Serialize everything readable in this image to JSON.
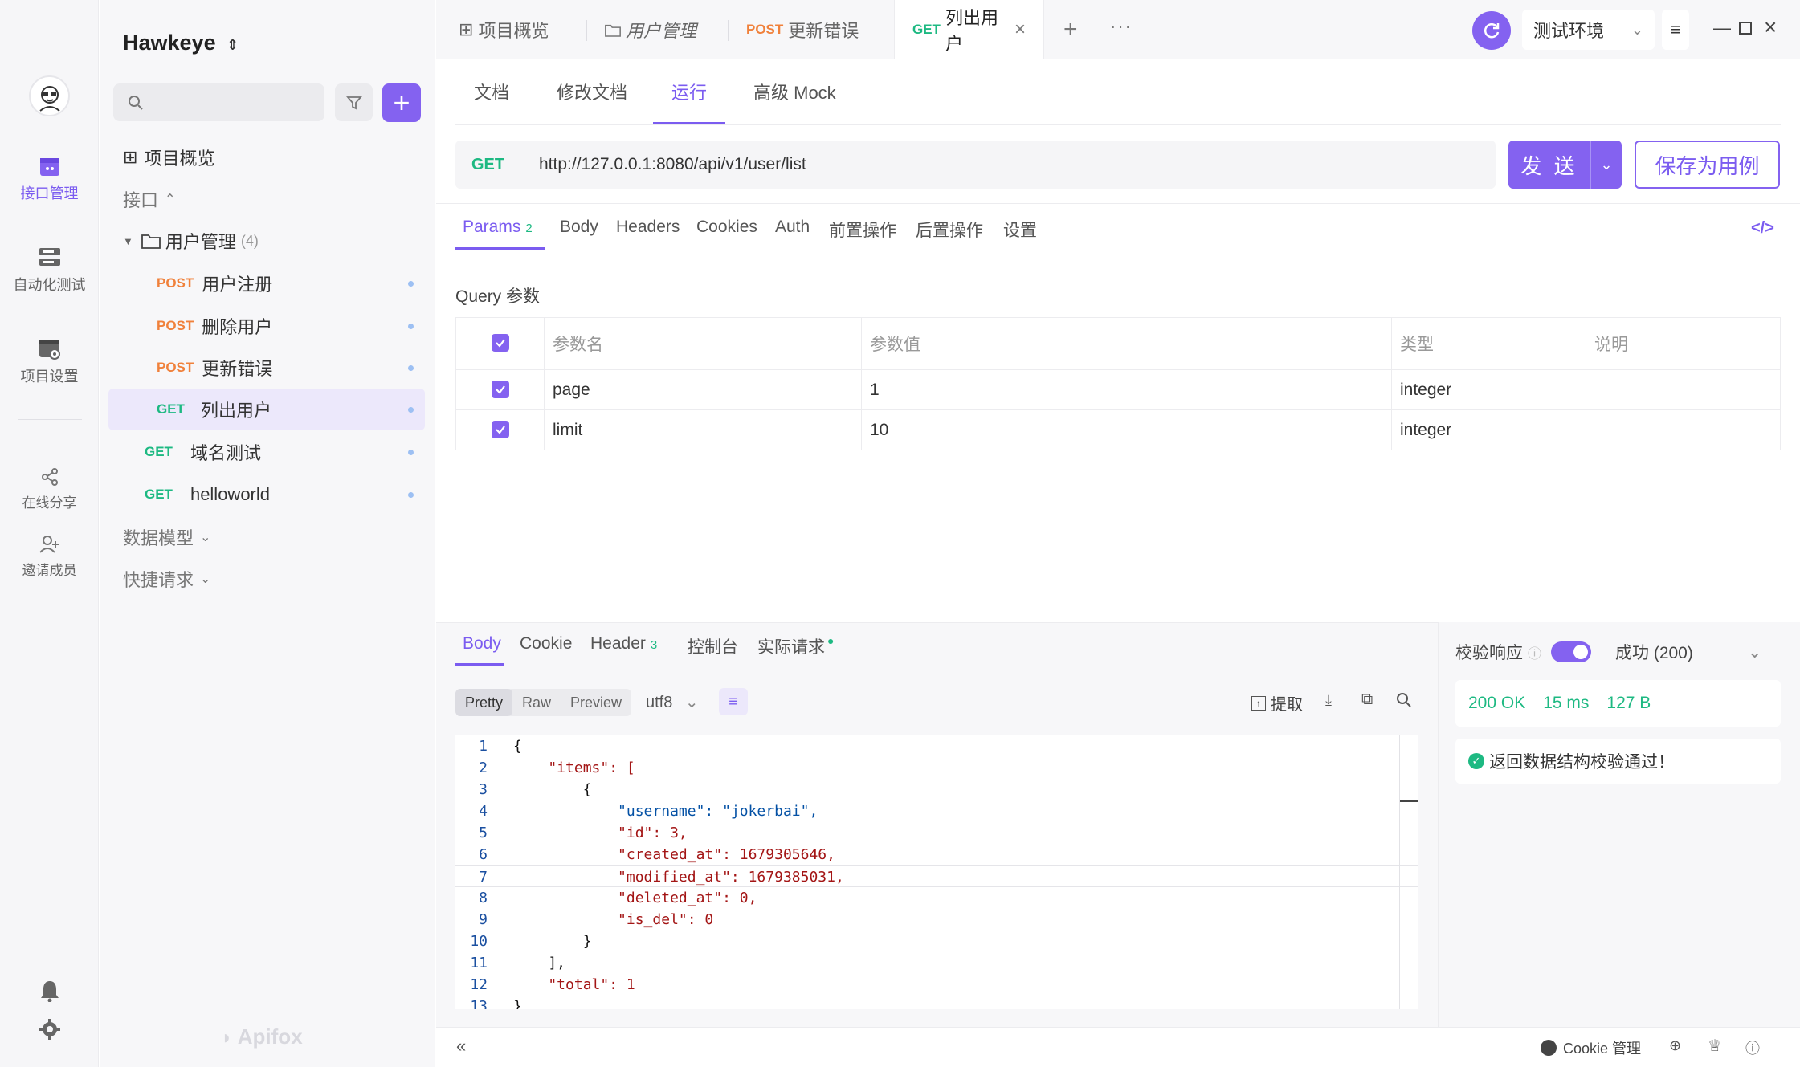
{
  "app": {
    "brand": "Apifox",
    "accent": "#8462f0"
  },
  "rail": {
    "items": [
      {
        "label": "接口管理",
        "icon": "api-manage-icon"
      },
      {
        "label": "自动化测试",
        "icon": "automation-icon"
      },
      {
        "label": "项目设置",
        "icon": "project-settings-icon"
      },
      {
        "label": "在线分享",
        "icon": "share-icon"
      },
      {
        "label": "邀请成员",
        "icon": "invite-icon"
      }
    ]
  },
  "sidebar": {
    "project_name": "Hawkeye",
    "project_overview": "项目概览",
    "section_api": "接口",
    "folder": {
      "label": "用户管理",
      "count": "(4)"
    },
    "folder_items": [
      {
        "method": "POST",
        "label": "用户注册"
      },
      {
        "method": "POST",
        "label": "删除用户"
      },
      {
        "method": "POST",
        "label": "更新错误"
      },
      {
        "method": "GET",
        "label": "列出用户"
      }
    ],
    "root_items": [
      {
        "method": "GET",
        "label": "域名测试"
      },
      {
        "method": "GET",
        "label": "helloworld"
      }
    ],
    "section_models": "数据模型",
    "section_quick": "快捷请求"
  },
  "tabs": [
    {
      "label": "项目概览"
    },
    {
      "label": "用户管理"
    },
    {
      "method": "POST",
      "label": "更新错误"
    },
    {
      "method": "GET",
      "label": "列出用户"
    }
  ],
  "env": {
    "label": "测试环境"
  },
  "subtabs": [
    "文档",
    "修改文档",
    "运行",
    "高级 Mock"
  ],
  "request": {
    "method": "GET",
    "url": "http://127.0.0.1:8080/api/v1/user/list",
    "send_label": "发 送",
    "save_label": "保存为用例"
  },
  "param_tabs": [
    {
      "label": "Params",
      "badge": "2"
    },
    {
      "label": "Body"
    },
    {
      "label": "Headers"
    },
    {
      "label": "Cookies"
    },
    {
      "label": "Auth"
    },
    {
      "label": "前置操作"
    },
    {
      "label": "后置操作"
    },
    {
      "label": "设置"
    }
  ],
  "query": {
    "title": "Query 参数",
    "headers": [
      "参数名",
      "参数值",
      "类型",
      "说明"
    ],
    "rows": [
      {
        "name": "page",
        "value": "1",
        "type": "integer",
        "desc": ""
      },
      {
        "name": "limit",
        "value": "10",
        "type": "integer",
        "desc": ""
      }
    ]
  },
  "response": {
    "tabs": [
      {
        "label": "Body"
      },
      {
        "label": "Cookie"
      },
      {
        "label": "Header",
        "badge": "3"
      },
      {
        "label": "控制台"
      },
      {
        "label": "实际请求"
      }
    ],
    "views": [
      "Pretty",
      "Raw",
      "Preview"
    ],
    "encoding": "utf8",
    "extract_label": "提取",
    "code_lines": [
      "{",
      "    \"items\": [",
      "        {",
      "            \"username\": \"jokerbai\",",
      "            \"id\": 3,",
      "            \"created_at\": 1679305646,",
      "            \"modified_at\": 1679385031,",
      "            \"deleted_at\": 0,",
      "            \"is_del\": 0",
      "        }",
      "    ],",
      "    \"total\": 1",
      "}"
    ],
    "validate_label": "校验响应",
    "validate_result": "成功 (200)",
    "status": "200 OK",
    "time": "15 ms",
    "size": "127 B",
    "schema_msg": "返回数据结构校验通过！"
  },
  "footer": {
    "cookie_label": "Cookie 管理"
  }
}
